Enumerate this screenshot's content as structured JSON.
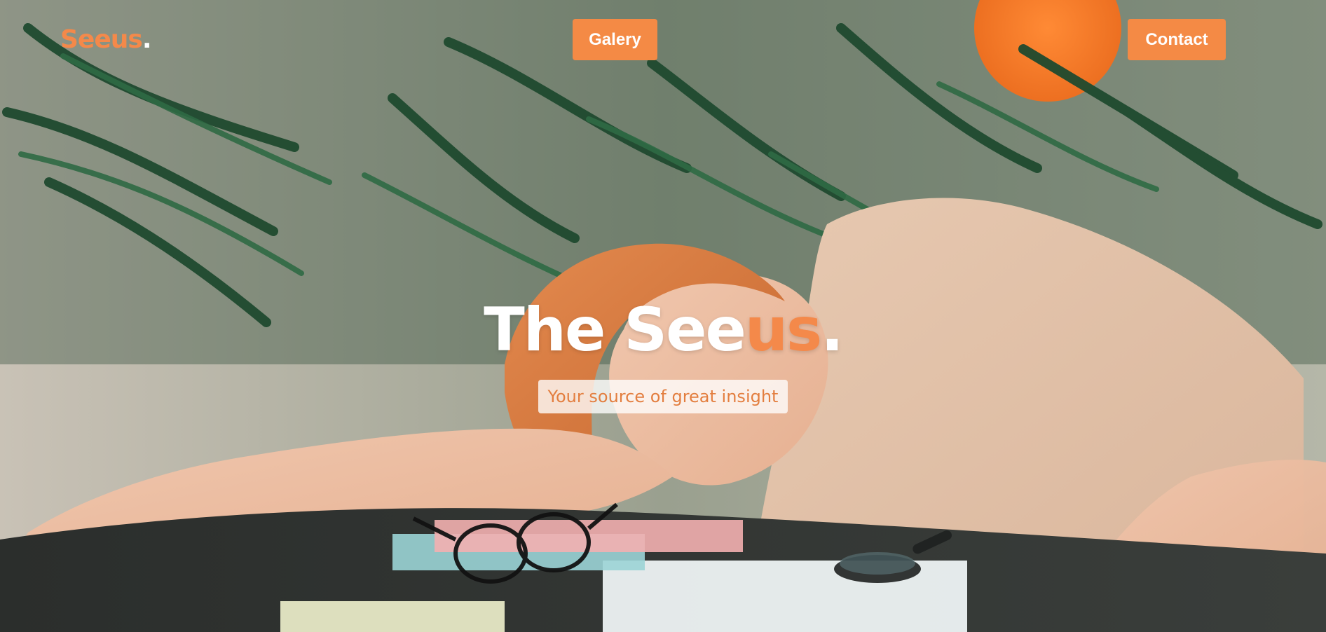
{
  "brand": {
    "logo_prefix": "Seeus",
    "logo_dot": "."
  },
  "nav": {
    "galery_label": "Galery",
    "contact_label": "Contact"
  },
  "hero": {
    "title_part1": "The See",
    "title_accent": "us",
    "title_dot": ".",
    "subtitle": "Your source of great insight"
  },
  "colors": {
    "accent": "#f48a45",
    "white": "#ffffff"
  },
  "icons": [
    "background-photo"
  ]
}
